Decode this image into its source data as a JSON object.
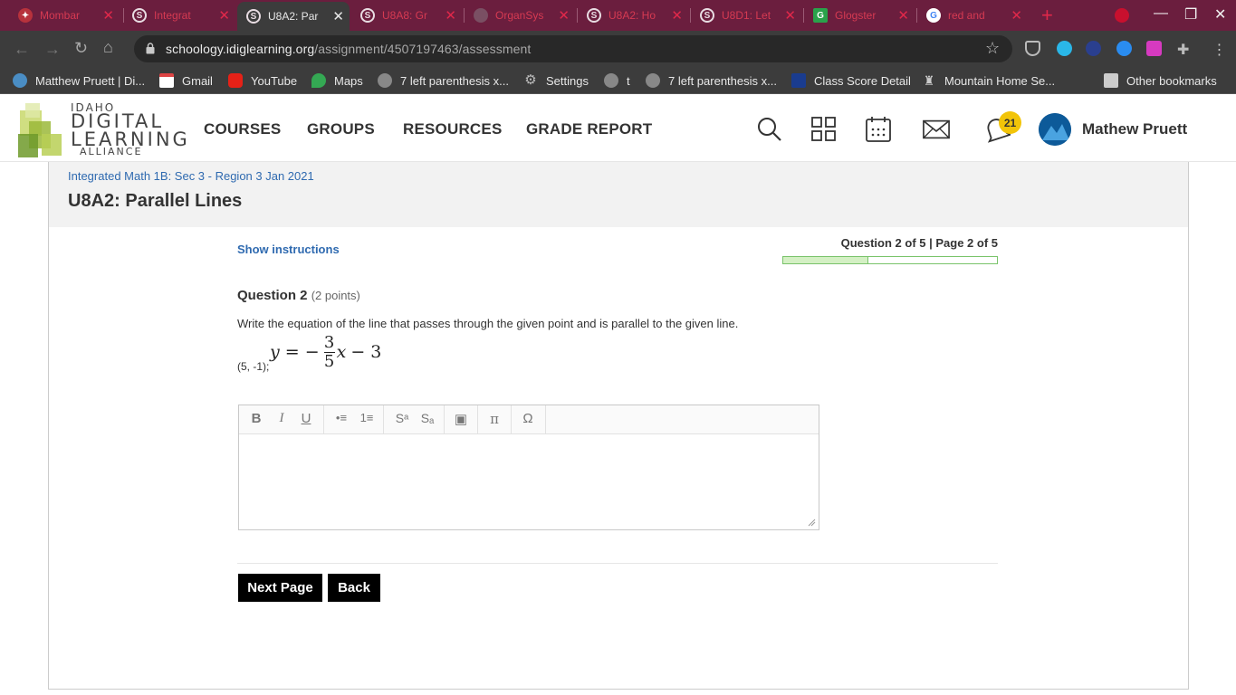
{
  "browser": {
    "tabs": [
      {
        "title": "Mombar",
        "icon": "idla-favicon"
      },
      {
        "title": "Integrat",
        "icon": "schoology-favicon"
      },
      {
        "title": "U8A2: Par",
        "icon": "schoology-favicon",
        "active": true
      },
      {
        "title": "U8A8: Gr",
        "icon": "schoology-favicon"
      },
      {
        "title": "OrganSys",
        "icon": "globe-favicon"
      },
      {
        "title": "U8A2: Ho",
        "icon": "schoology-favicon"
      },
      {
        "title": "U8D1: Let",
        "icon": "schoology-favicon"
      },
      {
        "title": "Glogster",
        "icon": "green-g-favicon"
      },
      {
        "title": "red and",
        "icon": "google-favicon"
      }
    ],
    "url_host": "schoology.idiglearning.org",
    "url_path": "/assignment/4507197463/assessment",
    "bookmarks": [
      {
        "label": "Matthew Pruett | Di...",
        "icon": "globe-icon"
      },
      {
        "label": "Gmail",
        "icon": "gmail-icon"
      },
      {
        "label": "YouTube",
        "icon": "youtube-icon"
      },
      {
        "label": "Maps",
        "icon": "maps-icon"
      },
      {
        "label": "7 left parenthesis x...",
        "icon": "globe-icon"
      },
      {
        "label": "Settings",
        "icon": "gear-icon"
      },
      {
        "label": "t",
        "icon": "globe-icon"
      },
      {
        "label": "7 left parenthesis x...",
        "icon": "globe-icon"
      },
      {
        "label": "Class Score Detail",
        "icon": "p-icon"
      },
      {
        "label": "Mountain Home Se...",
        "icon": "school-icon"
      },
      {
        "label": "Other bookmarks",
        "icon": "folder-icon"
      }
    ]
  },
  "site": {
    "logo": {
      "line1": "IDAHO",
      "line2": "DIGITAL",
      "line3": "LEARNING",
      "line4": "ALLIANCE"
    },
    "nav": [
      "COURSES",
      "GROUPS",
      "RESOURCES",
      "GRADE REPORT"
    ],
    "notifications_count": "21",
    "user_name": "Mathew Pruett"
  },
  "assignment": {
    "breadcrumb": "Integrated Math 1B: Sec 3 - Region 3 Jan 2021",
    "title": "U8A2: Parallel Lines",
    "show_instructions": "Show instructions",
    "question_counter": "Question 2 of 5 | Page 2 of 5",
    "progress_fraction": 0.4,
    "question_label": "Question 2",
    "question_points": "(2 points)",
    "prompt": "Write the equation of the line that passes through the given point and is parallel to the given line.",
    "point": "(5, -1);",
    "equation": {
      "lhs": "y",
      "eq": "= −",
      "num": "3",
      "den": "5",
      "rest_var": "x",
      "rest": "− 3"
    },
    "editor_tools": [
      "B",
      "I",
      "U",
      "•≡",
      "1≡",
      "Sᵃ",
      "Sₐ",
      "▣",
      "π",
      "Ω"
    ],
    "buttons": {
      "next": "Next Page",
      "back": "Back"
    }
  },
  "colors": {
    "tabstrip": "#6b1e3e",
    "chrome": "#3c3c3c",
    "link": "#2f6ab0",
    "progress_border": "#79c36a",
    "progress_fill": "#d4f0c4",
    "badge": "#f2c409"
  }
}
